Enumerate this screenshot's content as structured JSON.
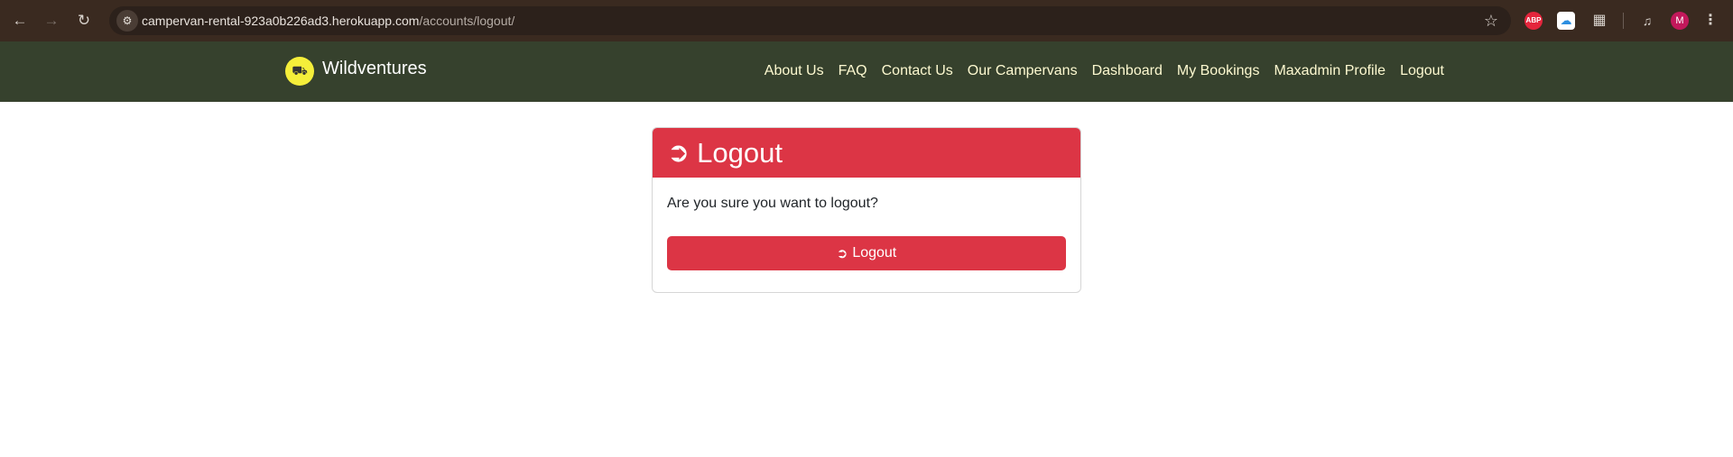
{
  "browser": {
    "url_host": "campervan-rental-923a0b226ad3.herokuapp.com",
    "url_path": "/accounts/logout/",
    "profile_initial": "M",
    "extension_label": "ABP"
  },
  "navbar": {
    "brand": "Wildventures",
    "links": [
      "About Us",
      "FAQ",
      "Contact Us",
      "Our Campervans",
      "Dashboard",
      "My Bookings",
      "Maxadmin Profile",
      "Logout"
    ]
  },
  "card": {
    "title": "Logout",
    "question": "Are you sure you want to logout?",
    "button_label": "Logout"
  },
  "colors": {
    "navbar_bg": "#36412d",
    "danger": "#dc3545",
    "nav_link": "#fdf9d0"
  },
  "icons": {
    "back": "back-arrow-icon",
    "forward": "forward-arrow-icon",
    "reload": "reload-icon",
    "logout": "logout-icon"
  }
}
